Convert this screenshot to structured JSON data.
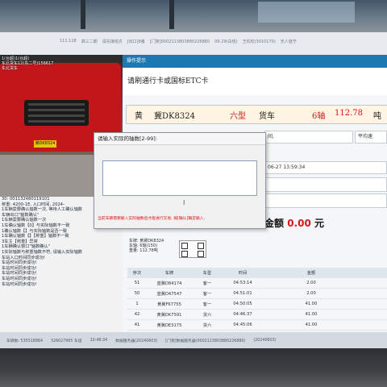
{
  "statusbar": [
    "111.118",
    "高三二期",
    "请先接班次",
    "[出口]8番",
    "[门架]0002113803880226880",
    "06-29(白班)",
    "王松松(3010170)",
    "无人值守"
  ],
  "video": {
    "overlay": [
      "1(台超)1(台超)",
      "东北货车12(东二号)156617",
      "东北货车"
    ],
    "plate": "冀DK8324"
  },
  "panel": {
    "header": "操作提示",
    "message": "请刷通行卡或国标ETC卡",
    "plate_color": "黄",
    "plate": "冀DK8324",
    "vehicle_type": "六型",
    "vehicle_class": "货车",
    "axles": "6轴",
    "weight": "112.78",
    "weight_unit": "吨",
    "field_entry": "间,",
    "field_avgspeed": "平均速",
    "field_time": "06-27 13:59:34",
    "amount_label": "金额",
    "amount_value": "0.00",
    "amount_unit": "元"
  },
  "mini": {
    "line1": "车牌: 黄冀DK8324",
    "line2": "车轴: 6轴(150)",
    "line3": "重量: 112.78吨"
  },
  "table": {
    "headers": [
      "序次",
      "车牌",
      "车型",
      "时间",
      "金额"
    ],
    "rows": [
      [
        "51",
        "蓝冀D84174",
        "客一",
        "04:53:14",
        "2.00"
      ],
      [
        "50",
        "蓝冀D47547",
        "客一",
        "04:51:01",
        "2.00"
      ],
      [
        "1",
        "黄冀F67755",
        "客一",
        "04:50:05",
        "41.00"
      ],
      [
        "42",
        "黄冀DK7591",
        "货六",
        "04:46:37",
        "41.00"
      ],
      [
        "41",
        "黄冀DE3175",
        "货六",
        "04:45:06",
        "41.00"
      ]
    ]
  },
  "log": [
    "30: 001132480119101",
    "称重: 4200-1E, 入口时间, 2024-",
    "1车辆需要确认轴数一次, 等待人工确认轴数",
    "车辆出口\"轴数确认\"",
    "1车辆需要确认轴数一次",
    "1车确认轴数【0】与实际轴数不一致",
    "1确认轴数【】与实际轴数是否一致",
    "1车确认轴数【】【称重】轴数不一致",
    "3车主【称重】异常",
    "1车辆确认窗口\"轴数确认\"",
    "1实际轴数与称重轴数不符, 请输入实际轴数",
    "车站入口时间同步成功!",
    "车站时间同步成功!",
    "车站时间同步成功!",
    "车站时间同步成功!",
    "车站时间同步成功!",
    "车站时间同步成功!"
  ],
  "dialog": {
    "title": "请输入实际的轴数[2-99]:",
    "hint": "当前车辆需要输入实际轴数后才能进行交易, 按[确认]确定输入."
  },
  "bottom": [
    "车辆数: 535518884",
    "326027965 车道",
    "10:48:34",
    "数据服务器(20240603)",
    "[门架]数据服务器(0002113803880226880)",
    "(20240603)"
  ],
  "colors": {
    "header_blue": "#1c79b0",
    "amount_red": "#d7151c",
    "plate_yellow": "#e9c417"
  }
}
